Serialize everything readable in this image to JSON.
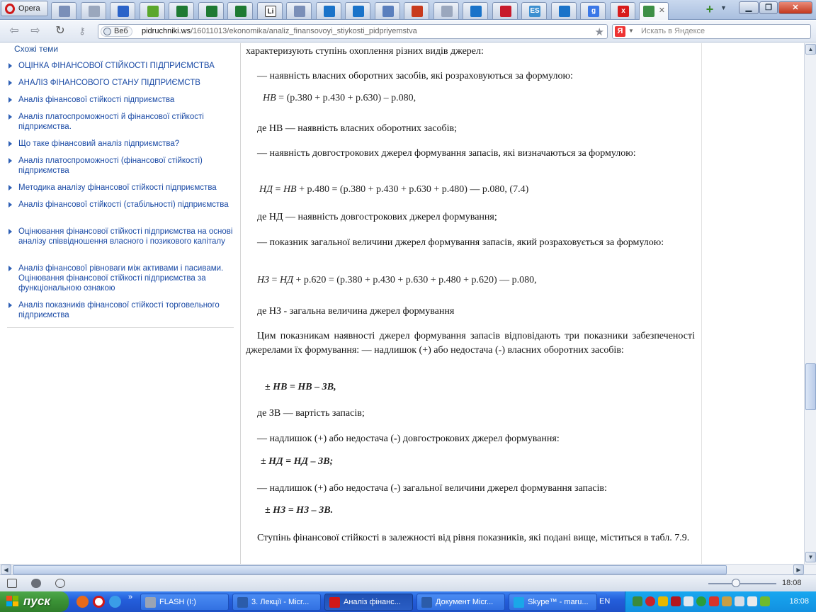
{
  "browser": {
    "menu_label": "Opera",
    "tabs": [
      {
        "icon": "page-icon",
        "color": "#7a8fb8"
      },
      {
        "icon": "doc-icon",
        "color": "#9aa7bd"
      },
      {
        "icon": "info-icon",
        "color": "#2a63c9"
      },
      {
        "icon": "apple-icon",
        "color": "#5aa72c"
      },
      {
        "icon": "excel-icon",
        "color": "#1e7a33"
      },
      {
        "icon": "excel-icon",
        "color": "#1e7a33"
      },
      {
        "icon": "excel-icon",
        "color": "#1e7a33"
      },
      {
        "icon": "li-icon",
        "color": "#222222",
        "text": "Li"
      },
      {
        "icon": "page-icon",
        "color": "#7a8fb8"
      },
      {
        "icon": "upload-icon",
        "color": "#1a73c9"
      },
      {
        "icon": "upload-icon",
        "color": "#1a73c9"
      },
      {
        "icon": "doc-icon",
        "color": "#5a7fbd"
      },
      {
        "icon": "site-icon",
        "color": "#c83a1c"
      },
      {
        "icon": "chart-icon",
        "color": "#9aa7bd"
      },
      {
        "icon": "upload-icon",
        "color": "#1a73c9"
      },
      {
        "icon": "graph-icon",
        "color": "#c81b2c"
      },
      {
        "icon": "es-icon",
        "color": "#3c8fd0",
        "text": "ES"
      },
      {
        "icon": "upload-icon",
        "color": "#1a73c9"
      },
      {
        "icon": "google-icon",
        "color": "#3b78e7",
        "text": "g"
      },
      {
        "icon": "x-icon",
        "color": "#d81b1b",
        "text": "x"
      },
      {
        "icon": "books-icon",
        "color": "#3d8f46"
      }
    ],
    "url_web_label": "Веб",
    "url_host": "pidruchniki.ws",
    "url_path": "/16011013/ekonomika/analiz_finansovoyi_stiykosti_pidpriyemstva",
    "search_engine": "Я",
    "search_placeholder": "Искать в Яндексе"
  },
  "sidebar": {
    "title": "Схожі теми",
    "links": [
      "ОЦІНКА ФІНАНСОВОЇ СТІЙКОСТІ ПІДПРИЄМСТВА",
      "АНАЛІЗ ФІНАНСОВОГО СТАНУ ПІДПРИЄМСТВ",
      "Аналіз фінансової стійкості підприємства",
      "Аналіз платоспроможності й фінансової стійкості підприємства.",
      "Що таке фінансовий аналіз підприємства?",
      "Аналіз платоспроможності (фінансової стійкості) підприємства",
      "Методика аналізу фінансової стійкості підприємства",
      "Аналіз фінансової стійкості (стабільності) підприємства",
      "Оцінювання фінансової стійкості підприємства на основі аналізу співвідношення власного і позикового капіталу",
      "Аналіз фінансової рівноваги між активами і пасивами. Оцінювання фінансової стійкості підприємства за функціональною ознакою",
      "Аналіз показників фінансової стійкості торговельного підприємства"
    ]
  },
  "article": {
    "p1": "характеризують ступінь охоплення різних видів джерел:",
    "p2": "— наявність власних оборотних засобів, які розраховуються за формулою:",
    "f1_lhs": "НВ",
    "f1_rhs": " = (р.380 + р.430 + р.630) – р.080,",
    "p3": "де НВ — наявність власних оборотних засобів;",
    "p4": "— наявність довгострокових джерел формування запасів, які визначаються за формулою:",
    "f2_lhs": "НД",
    "f2_mid": " = ",
    "f2_nv": "НВ",
    "f2_rhs": " + р.480 = (р.380 + р.430 + р.630 + р.480) — р.080, (7.4)",
    "p5": "де НД — наявність довгострокових джерел формування;",
    "p6": "— показник загальної величини джерел формування запасів, який розраховується за формулою:",
    "f3_lhs": "НЗ",
    "f3_mid": " = ",
    "f3_nd": "НД",
    "f3_rhs": " + р.620 = (р.380 + р.430 + р.630 + р.480 + р.620) — р.080,",
    "p7": "де НЗ - загальна величина джерел формування",
    "p8": "Цим показникам наявності джерел формування запасів відповідають три показники забезпеченості джерелами їх формування: — надлишок (+) або недостача (-) власних оборотних засобів:",
    "f4": "± НВ = НВ – ЗВ,",
    "p9": "де ЗВ — вартість запасів;",
    "p10": "— надлишок (+) або недостача (-) довгострокових джерел формування:",
    "f5": "± НД = НД – ЗВ;",
    "p11": "— надлишок (+) або недостача (-) загальної величини джерел формування запасів:",
    "f6": "± НЗ = НЗ – ЗВ.",
    "p12": "Ступінь фінансової стійкості в залежності від рівня показників, які подані вище, міститься в табл. 7.9."
  },
  "taskbar": {
    "start_label": "пуск",
    "tasks": [
      {
        "label": "FLASH (I:)",
        "icon": "drive-icon",
        "color": "#9aa4b4",
        "active": false
      },
      {
        "label": "3. Лекції - Micr...",
        "icon": "word-icon",
        "color": "#2b5caa",
        "active": false
      },
      {
        "label": "Аналіз фінанс...",
        "icon": "opera-icon",
        "color": "#d01818",
        "active": true
      },
      {
        "label": "Документ Micr...",
        "icon": "word-icon",
        "color": "#2b5caa",
        "active": false
      },
      {
        "label": "Skype™ - maru...",
        "icon": "skype-icon",
        "color": "#1aa7e8",
        "active": false
      }
    ],
    "language": "EN",
    "clock": "18:08"
  }
}
